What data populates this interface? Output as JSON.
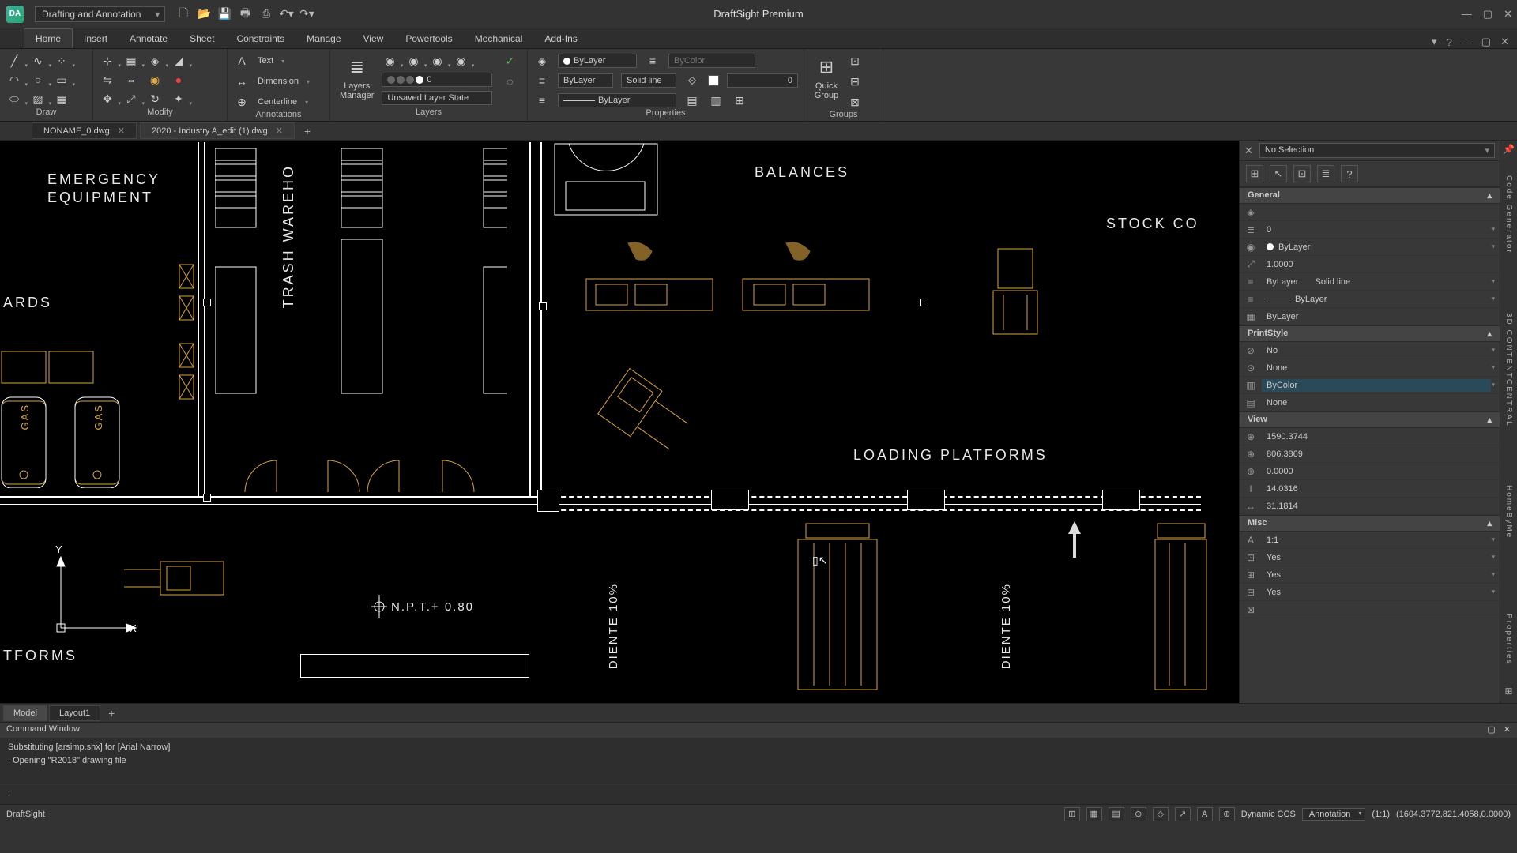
{
  "title": "DraftSight Premium",
  "workspace": "Drafting and Annotation",
  "menu": {
    "tabs": [
      "Home",
      "Insert",
      "Annotate",
      "Sheet",
      "Constraints",
      "Manage",
      "View",
      "Powertools",
      "Mechanical",
      "Add-Ins"
    ],
    "active": "Home"
  },
  "ribbon": {
    "draw": "Draw",
    "modify": "Modify",
    "ann": {
      "label": "Annotations",
      "text": "Text",
      "dim": "Dimension",
      "cl": "Centerline"
    },
    "layers": {
      "label": "Layers",
      "mgr": "Layers\nManager",
      "state": "Unsaved Layer State"
    },
    "props": {
      "label": "Properties",
      "bylayer": "ByLayer",
      "solid": "Solid line",
      "bycolor": "ByColor",
      "zero": "0"
    },
    "qg": "Quick\nGroup",
    "groups": "Groups"
  },
  "doctabs": {
    "t1": "NONAME_0.dwg",
    "t2": "2020 - Industry A_edit (1).dwg"
  },
  "canvas": {
    "emergency": "EMERGENCY\nEQUIPMENT",
    "ards": "ARDS",
    "trash": "TRASH WAREHO",
    "balances": "BALANCES",
    "stock": "STOCK CO",
    "loading": "LOADING PLATFORMS",
    "tforms": "TFORMS",
    "npt": "N.P.T.+ 0.80",
    "diente": "DIENTE 10%",
    "gas": "GAS",
    "x": "X",
    "y": "Y"
  },
  "props_panel": {
    "nosel": "No Selection",
    "general": {
      "hdr": "General",
      "layer": "0",
      "color": "ByLayer",
      "scale": "1.0000",
      "lt": "ByLayer",
      "lts": "Solid line",
      "lw": "ByLayer",
      "ps": "ByLayer"
    },
    "print": {
      "hdr": "PrintStyle",
      "a": "No",
      "b": "None",
      "c": "ByColor",
      "d": "None"
    },
    "view": {
      "hdr": "View",
      "cx": "1590.3744",
      "cy": "806.3869",
      "cz": "0.0000",
      "h": "14.0316",
      "w": "31.1814"
    },
    "misc": {
      "hdr": "Misc",
      "a": "1:1",
      "b": "Yes",
      "c": "Yes",
      "d": "Yes"
    }
  },
  "bottabs": {
    "model": "Model",
    "layout": "Layout1"
  },
  "cmd": {
    "hdr": "Command Window",
    "l1": "Substituting [arsimp.shx] for [Arial Narrow]",
    "l2": ": Opening \"R2018\" drawing file",
    "prompt": ":"
  },
  "status": {
    "app": "DraftSight",
    "dccs": "Dynamic CCS",
    "ann": "Annotation",
    "scale": "(1:1)",
    "coords": "(1604.3772,821.4058,0.0000)"
  },
  "rails": {
    "r1": "Code Generator",
    "r2": "3D CONTENTCENTRAL",
    "r3": "HomeByMe",
    "r4": "Properties"
  }
}
